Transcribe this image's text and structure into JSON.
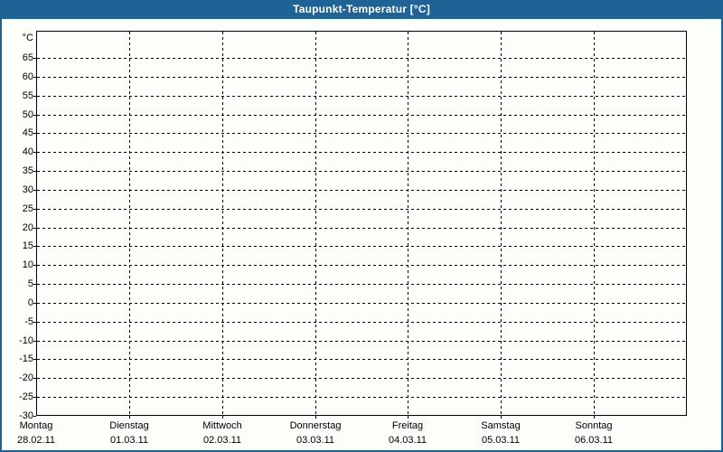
{
  "window": {
    "title": "Taupunkt-Temperatur [°C]"
  },
  "colors": {
    "titlebar_bg": "#1F6396",
    "titlebar_text": "#FFFFFF",
    "window_border": "#1F6396",
    "background": "#FCFEFA",
    "axis": "#000000",
    "gridline": "#000000",
    "text": "#000000"
  },
  "chart_data": {
    "type": "line",
    "title": "Taupunkt-Temperatur [°C]",
    "ylabel": "°C",
    "ylim": [
      -30,
      72
    ],
    "ytick_step": 5,
    "yticks": [
      65,
      60,
      55,
      50,
      45,
      40,
      35,
      30,
      25,
      20,
      15,
      10,
      5,
      0,
      -5,
      -10,
      -15,
      -20,
      -25,
      -30
    ],
    "grid": "dashed",
    "legend": "none",
    "x_categories": [
      {
        "day": "Montag",
        "date": "28.02.11"
      },
      {
        "day": "Dienstag",
        "date": "01.03.11"
      },
      {
        "day": "Mittwoch",
        "date": "02.03.11"
      },
      {
        "day": "Donnerstag",
        "date": "03.03.11"
      },
      {
        "day": "Freitag",
        "date": "04.03.11"
      },
      {
        "day": "Samstag",
        "date": "05.03.11"
      },
      {
        "day": "Sonntag",
        "date": "06.03.11"
      }
    ],
    "series": []
  }
}
